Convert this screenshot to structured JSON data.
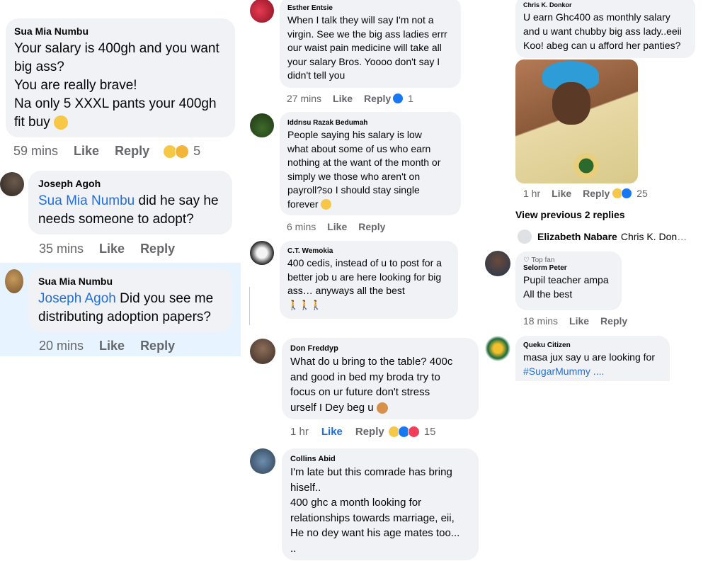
{
  "col1": {
    "c1": {
      "author": "Sua Mia Numbu",
      "text": "Your salary is 400gh and you want\nbig ass?\nYou are really brave!\nNa only 5 XXXL  pants your 400gh\nfit buy",
      "time": "59 mins",
      "like": "Like",
      "reply": "Reply",
      "count": "5"
    },
    "c2": {
      "author": "Joseph Agoh",
      "mention": "Sua Mia Numbu",
      "text": " did he say he\nneeds someone to adopt?",
      "time": "35 mins",
      "like": "Like",
      "reply": "Reply"
    },
    "c3": {
      "author": "Sua Mia Numbu",
      "mention": "Joseph Agoh",
      "text": " Did you see me\ndistributing adoption papers?",
      "time": "20 mins",
      "like": "Like",
      "reply": "Reply"
    }
  },
  "col2": {
    "c1": {
      "author": "Esther Entsie",
      "text": "When I talk they will say I'm not a\nvirgin. See we the big ass ladies errr\nour waist pain medicine will take all\nyour salary Bros. Yoooo don't say I\ndidn't tell you",
      "time": "27 mins",
      "like": "Like",
      "reply": "Reply",
      "count": "1"
    },
    "c2": {
      "author": "Iddrısu Razak Bedumah",
      "text": "People saying his salary is low\nwhat about some of us who earn\nnothing at the want of the month or\nsimply we those who aren't on\npayroll?so I should stay single\nforever",
      "time": "6 mins",
      "like": "Like",
      "reply": "Reply"
    },
    "c3": {
      "author": "C.T. Wemokia",
      "text": "400 cedis, instead of u to post for a\nbetter job u are here looking for big\nass… anyways all the best",
      "walkers": "🚶🚶🚶"
    },
    "c4": {
      "author": "Don Freddyp",
      "text": "What do u bring to the table? 400c\nand good in bed  my broda try to\nfocus on ur future don't stress\nurself I Dey beg u",
      "time": "1 hr",
      "like": "Like",
      "reply": "Reply",
      "count": "15"
    },
    "c5": {
      "author": "Collins Abid",
      "text": "I'm late but this comrade has bring\nhiself..\n400 ghc a month looking for\nrelationships towards marriage, eii,\nHe no dey want his age mates too...\n.."
    }
  },
  "col3": {
    "c1": {
      "author": "Chris K. Donkor",
      "text": "U earn Ghc400 as monthly salary\nand u want chubby big ass lady..eeii\nKoo! abeg can u afford her panties?",
      "time": "1 hr",
      "like": "Like",
      "reply": "Reply",
      "count": "25"
    },
    "view_previous": "View previous 2 replies",
    "preview": {
      "author": "Elizabeth Nabare",
      "text": "Chris K. Don"
    },
    "c2": {
      "badge": "Top fan",
      "author": "Selorm Peter",
      "text": "Pupil teacher ampa\nAll the best",
      "time": "18 mins",
      "like": "Like",
      "reply": "Reply"
    },
    "c3": {
      "author": "Queku Citizen",
      "text": "masa jux say u are looking for",
      "hashtag": "#SugarMummy ...."
    }
  },
  "colors": {
    "bubble": "#f0f2f5",
    "link": "#216fdb",
    "meta": "#65676b",
    "reply_highlight": "#e7f3ff"
  }
}
